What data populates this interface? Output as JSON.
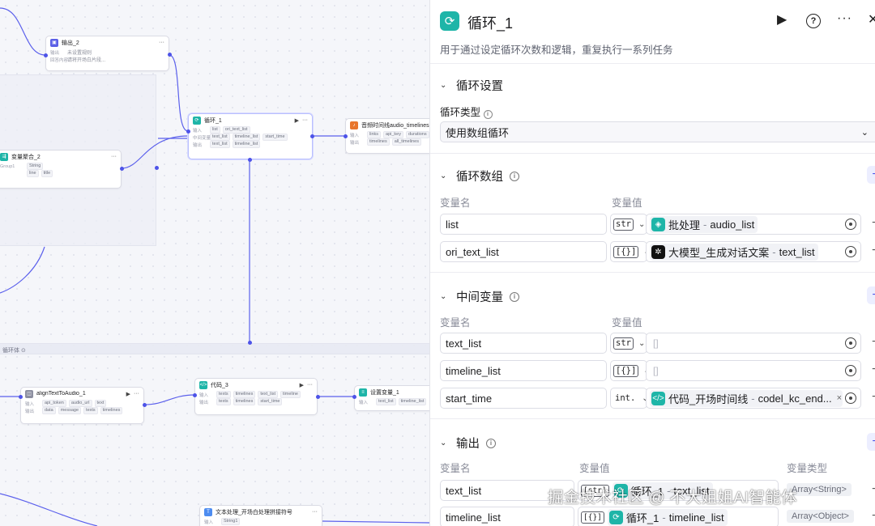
{
  "canvas": {
    "loop_body_label": "循环体",
    "nodes": {
      "output2": {
        "title": "输出_2",
        "r1_label": "输出",
        "r1_value": "未设置规则",
        "r2_label": "回答内容",
        "r2_value": "请将开场白片段..."
      },
      "varagg2": {
        "title": "变量聚合_2",
        "r1_label": "Group1",
        "r1_chip": "String",
        "r2_chip1": "line",
        "r2_chip2": "title"
      },
      "loop1": {
        "title": "循环_1",
        "r1_label": "输入",
        "r1_chips": [
          "list",
          "ori_text_list"
        ],
        "r2_label": "中间变量",
        "r2_chips": [
          "text_list",
          "timeline_list",
          "start_time"
        ],
        "r3_label": "输出",
        "r3_chips": [
          "text_list",
          "timeline_list"
        ]
      },
      "audio_timeline": {
        "title": "音频时间线audio_timelines",
        "r1_label": "输入",
        "r1_chips": [
          "links",
          "api_key",
          "durations"
        ],
        "r2_label": "输出",
        "r2_chips": [
          "timelines",
          "all_timelines"
        ]
      },
      "align": {
        "title": "alignTextToAudio_1",
        "r1_label": "输入",
        "r1_chips": [
          "api_token",
          "audio_url",
          "text"
        ],
        "r2_label": "输出",
        "r2_chips": [
          "data",
          "message",
          "texts",
          "timelines"
        ]
      },
      "code3": {
        "title": "代码_3",
        "r1_label": "输入",
        "r1_chips": [
          "texts",
          "timelines",
          "text_list",
          "timeline"
        ],
        "r2_label": "输出",
        "r2_chips": [
          "texts",
          "timelines",
          "start_time"
        ]
      },
      "setvar1": {
        "title": "设置变量_1",
        "r1_label": "输入",
        "r1_chips": [
          "text_list",
          "timeline_list"
        ]
      },
      "textproc": {
        "title": "文本处理_开场白处理拼接符号",
        "r1_label": "输入",
        "r1_chips": [
          "String1"
        ]
      }
    }
  },
  "panel": {
    "title": "循环_1",
    "description": "用于通过设定循环次数和逻辑，重复执行一系列任务",
    "colors": {
      "accent": "#4d53e8",
      "loop_teal": "#1eb5a8"
    },
    "header_icons": [
      "run-icon",
      "help-icon",
      "more-icon",
      "close-icon"
    ],
    "loop_settings": {
      "title": "循环设置",
      "type_label": "循环类型",
      "type_value": "使用数组循环"
    },
    "loop_array": {
      "title": "循环数组",
      "col_name": "变量名",
      "col_value": "变量值",
      "rows": [
        {
          "name": "list",
          "type": "str",
          "source": "批处理",
          "sep": "-",
          "var": "audio_list"
        },
        {
          "name": "ori_text_list",
          "type": "[{}]",
          "source": "大模型_生成对话文案",
          "sep": "-",
          "var": "text_list"
        }
      ]
    },
    "intermediate": {
      "title": "中间变量",
      "col_name": "变量名",
      "col_value": "变量值",
      "rows": [
        {
          "name": "text_list",
          "type": "str",
          "placeholder": "[]"
        },
        {
          "name": "timeline_list",
          "type": "[{}]",
          "placeholder": "[]"
        },
        {
          "name": "start_time",
          "type": "int.",
          "source": "代码_开场时间线",
          "sep": "-",
          "var": "codel_kc_end..."
        }
      ]
    },
    "output": {
      "title": "输出",
      "col_name": "变量名",
      "col_value": "变量值",
      "col_type": "变量类型",
      "rows": [
        {
          "name": "text_list",
          "type": "[str]",
          "source": "循环_1",
          "sep": "-",
          "var": "text_list",
          "vartype": "Array<String>"
        },
        {
          "name": "timeline_list",
          "type": "[{}]",
          "source": "循环_1",
          "sep": "-",
          "var": "timeline_list",
          "vartype": "Array<Object>"
        }
      ]
    }
  },
  "watermark": "掘金技术社区 @ 不大姐姐AI智能体"
}
